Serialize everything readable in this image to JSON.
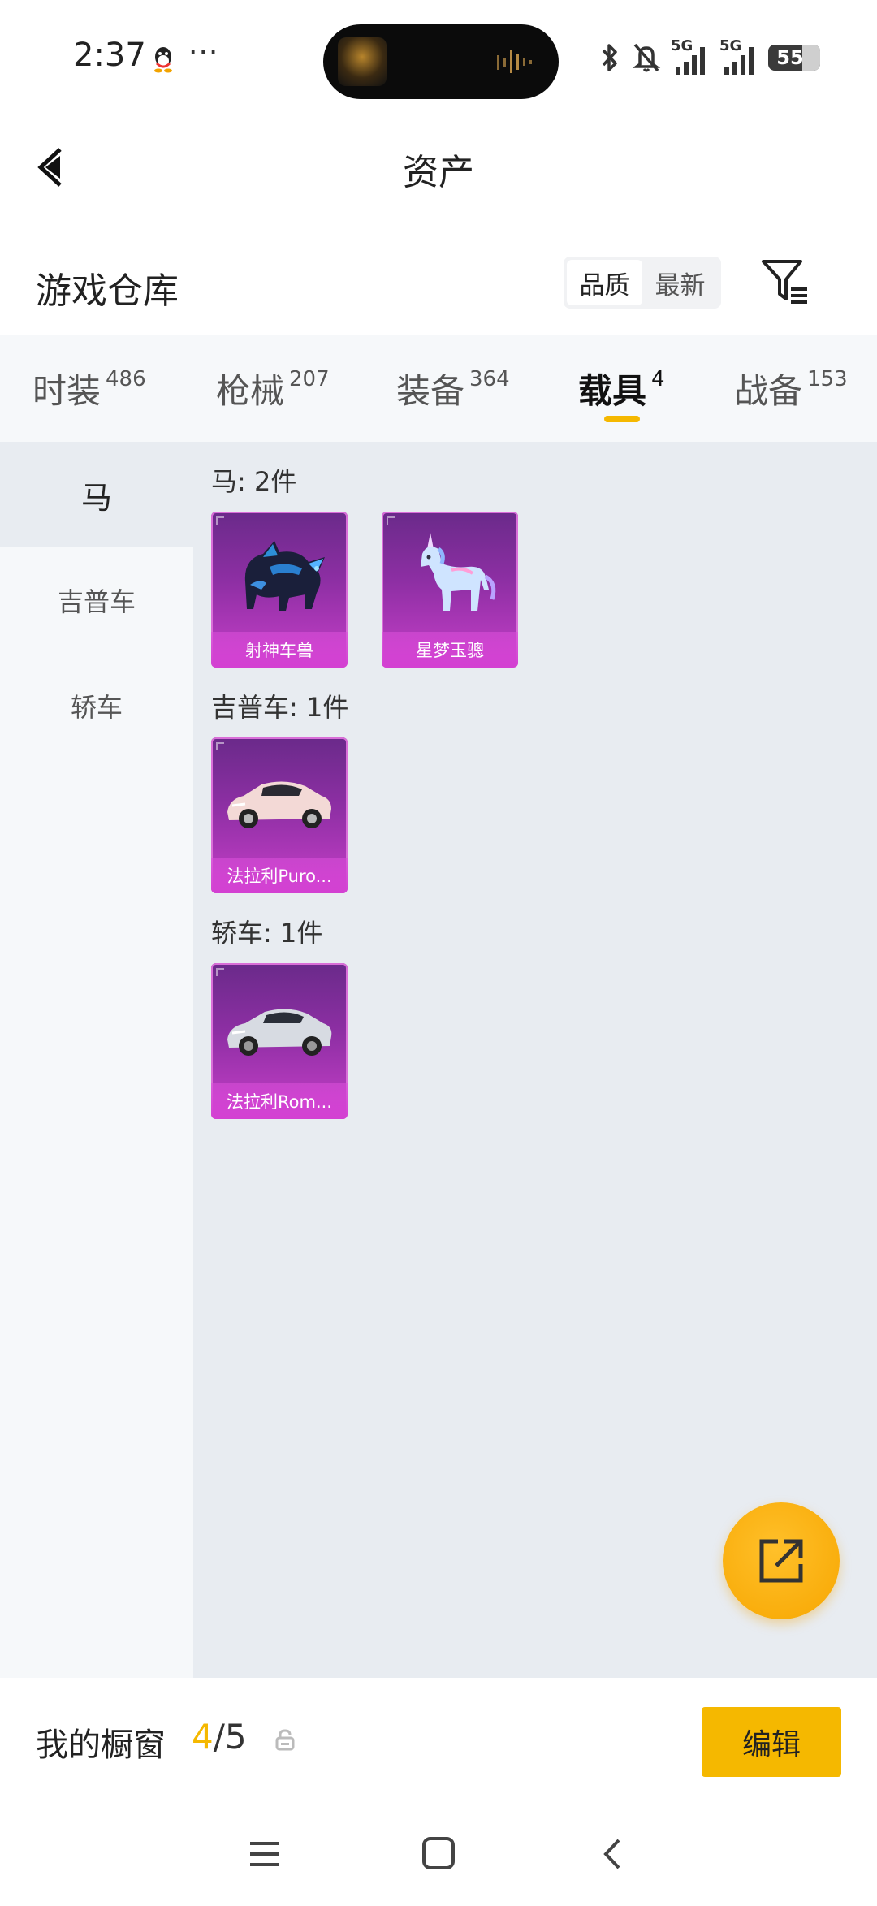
{
  "status_bar": {
    "time": "2:37",
    "more": "···",
    "network_1": "5G",
    "network_2": "5G",
    "battery": "55",
    "battery_level": 0.55
  },
  "header": {
    "title": "资产"
  },
  "section": {
    "title": "游戏仓库",
    "sort_options": [
      "品质",
      "最新"
    ],
    "active_sort": "品质"
  },
  "tabs": [
    {
      "label": "时装",
      "count": "486"
    },
    {
      "label": "枪械",
      "count": "207"
    },
    {
      "label": "装备",
      "count": "364"
    },
    {
      "label": "载具",
      "count": "4"
    },
    {
      "label": "战备",
      "count": "153"
    }
  ],
  "active_tab": "载具",
  "sidebar": {
    "items": [
      "马",
      "吉普车",
      "轿车"
    ],
    "active": "马"
  },
  "groups": [
    {
      "title": "马: 2件",
      "items": [
        {
          "name": "射神车兽",
          "icon": "armored-beast-icon"
        },
        {
          "name": "星梦玉骢",
          "icon": "crystal-unicorn-icon"
        }
      ]
    },
    {
      "title": "吉普车: 1件",
      "items": [
        {
          "name": "法拉利Puro...",
          "icon": "pink-car-icon"
        }
      ]
    },
    {
      "title": "轿车: 1件",
      "items": [
        {
          "name": "法拉利Rom...",
          "icon": "silver-car-icon"
        }
      ]
    }
  ],
  "showcase": {
    "title": "我的橱窗",
    "current": "4",
    "total": "/5",
    "edit_label": "编辑"
  },
  "colors": {
    "accent": "#f5b800",
    "card_purple": "#a331b8",
    "content_bg": "#e8ecf1",
    "sidebar_bg": "#f6f8fa"
  }
}
